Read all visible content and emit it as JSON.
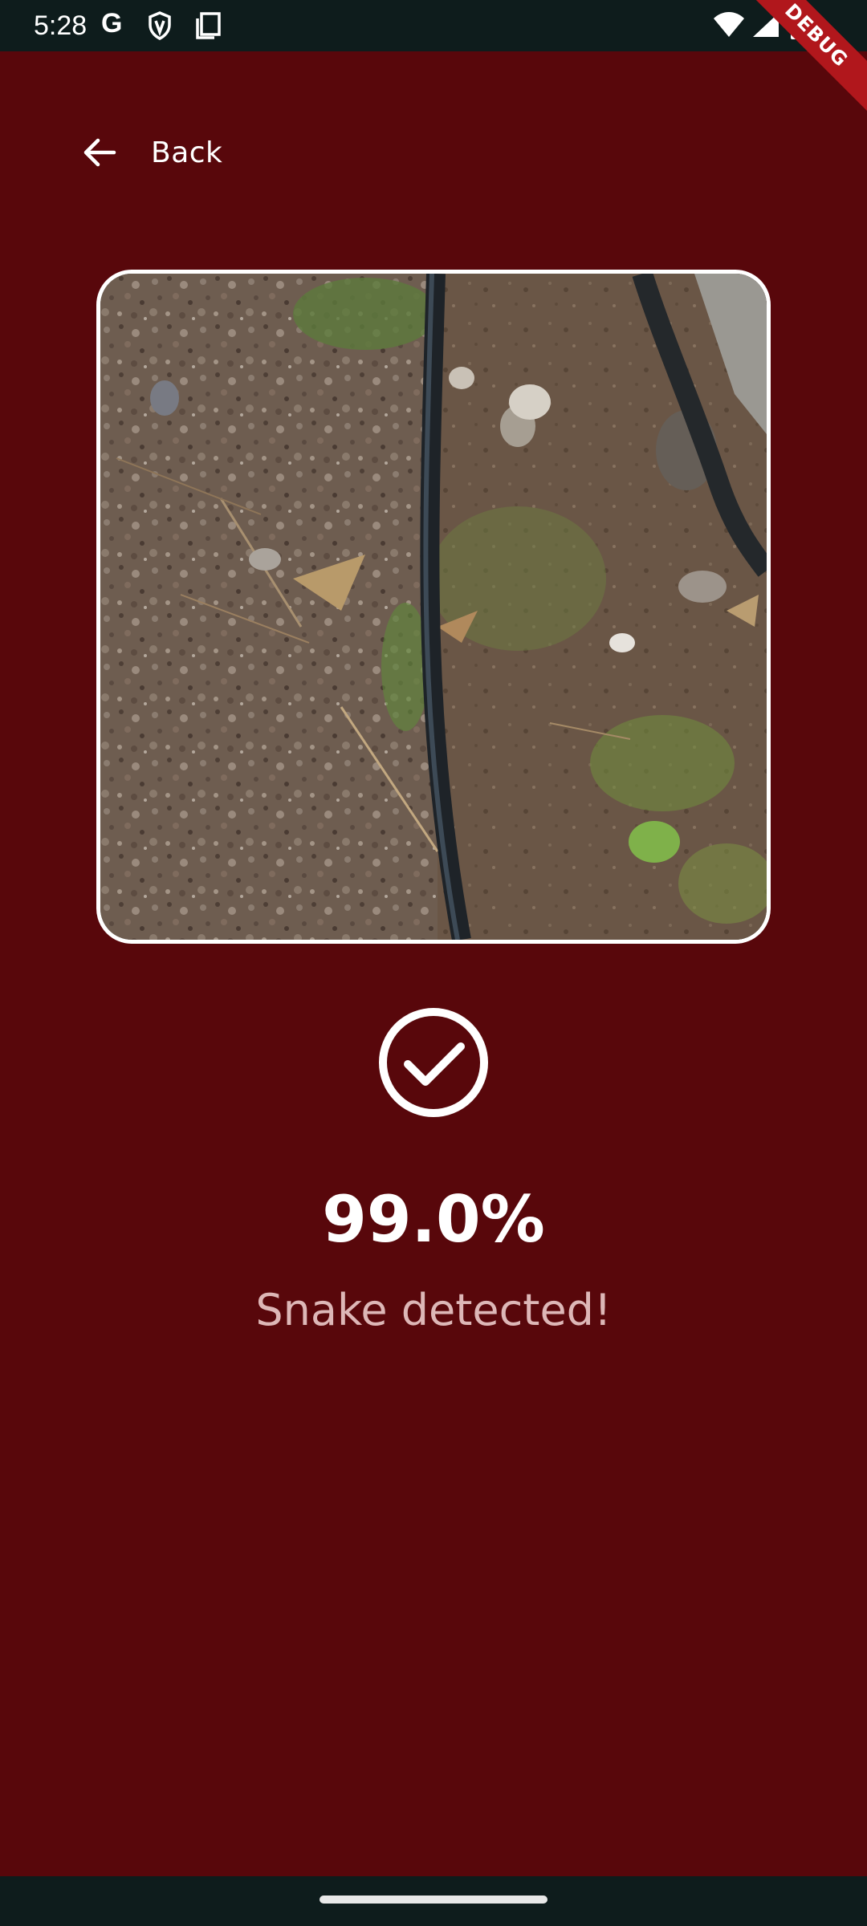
{
  "status_bar": {
    "time": "5:28",
    "left_icons": [
      "google-g-icon",
      "shield-icon",
      "copy-icon"
    ],
    "right_icons": [
      "wifi-icon",
      "signal-icon",
      "battery-icon"
    ],
    "g_glyph": "G"
  },
  "debug_banner": "DEBUG",
  "header": {
    "back_label": "Back"
  },
  "photo": {
    "subject": "ground-photo-with-irrigation-hose"
  },
  "result": {
    "confidence": "99.0%",
    "message": "Snake detected!",
    "status_icon": "check-circle-icon"
  },
  "colors": {
    "background": "#58070b",
    "system_bars": "#0e1c1c",
    "primary_text": "#ffffff",
    "secondary_text": "#ddb7b7",
    "debug_banner": "#b1171c"
  }
}
